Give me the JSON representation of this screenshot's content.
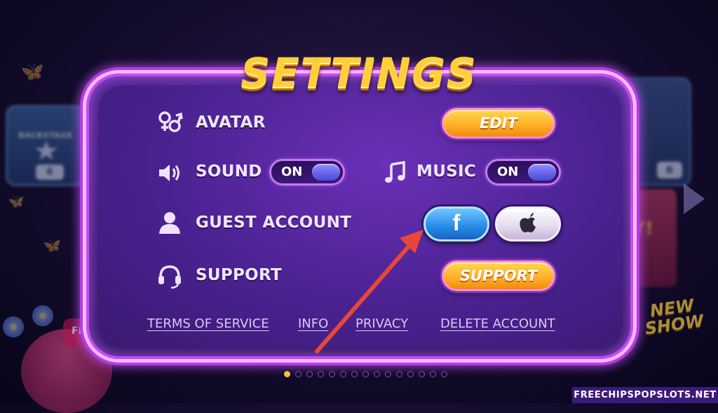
{
  "title": "SETTINGS",
  "rows": {
    "avatar": {
      "label": "AVATAR",
      "button": "EDIT",
      "icon": "gender-icon"
    },
    "sound": {
      "label": "SOUND",
      "toggle": "ON",
      "icon": "speaker-icon"
    },
    "music": {
      "label": "MUSIC",
      "toggle": "ON",
      "icon": "music-note-icon"
    },
    "account": {
      "label": "GUEST ACCOUNT",
      "icon": "user-icon",
      "login_buttons": [
        "facebook-icon",
        "apple-icon"
      ]
    },
    "support": {
      "label": "SUPPORT",
      "button": "SUPPORT",
      "icon": "headset-icon"
    }
  },
  "links": {
    "terms": "TERMS OF SERVICE",
    "info": "INFO",
    "privacy": "PRIVACY",
    "delete": "DELETE ACCOUNT"
  },
  "background": {
    "left_card": {
      "caption": "BACKSTAGE",
      "count": "6"
    },
    "right_card": {
      "count": "6"
    },
    "right_card2": {
      "text": "Y!"
    },
    "new_show": "NEW SHOW",
    "left_bottom": "FR"
  },
  "pager": {
    "total": 15,
    "active": 0
  },
  "watermark": "FREECHIPSPOPSLOTS.NET",
  "colors": {
    "panel": "#4a2290",
    "gold_button": "#ffb12a",
    "facebook": "#2b8ee8",
    "annotation_arrow": "#e8463a"
  }
}
